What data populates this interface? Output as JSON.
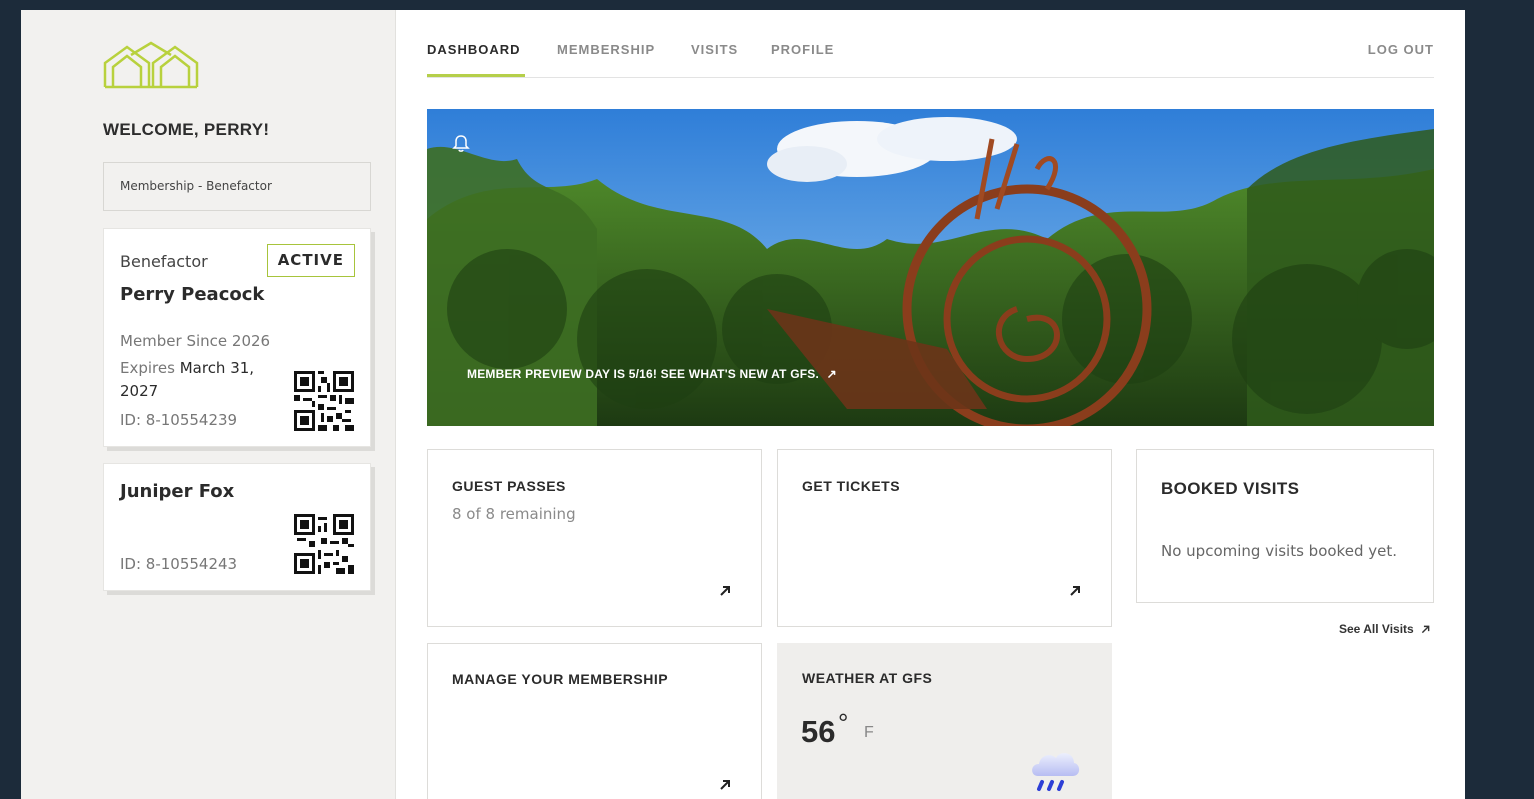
{
  "sidebar": {
    "welcome": "WELCOME, PERRY!",
    "membership_select": "Membership - Benefactor",
    "members": [
      {
        "tier": "Benefactor",
        "status": "ACTIVE",
        "name": "Perry Peacock",
        "since": "Member Since 2026",
        "expires_label": "Expires",
        "expires_value": "March 31, 2027",
        "id": "ID: 8-10554239"
      },
      {
        "name": "Juniper Fox",
        "id": "ID: 8-10554243"
      }
    ]
  },
  "nav": {
    "items": [
      "DASHBOARD",
      "MEMBERSHIP",
      "VISITS",
      "PROFILE"
    ],
    "active": "DASHBOARD",
    "logout": "LOG OUT"
  },
  "hero": {
    "caption": "MEMBER PREVIEW DAY IS 5/16! SEE WHAT'S NEW AT GFS.",
    "caption_arrow": "↗"
  },
  "tiles": {
    "guest_passes": {
      "title": "GUEST PASSES",
      "subtitle": "8 of 8 remaining"
    },
    "get_tickets": {
      "title": "GET TICKETS"
    },
    "booked_visits": {
      "title": "BOOKED VISITS",
      "empty": "No upcoming visits booked yet."
    },
    "see_all": "See All Visits",
    "manage": {
      "title": "MANAGE YOUR MEMBERSHIP"
    },
    "weather": {
      "title": "WEATHER AT GFS",
      "temp": "56",
      "deg": "°",
      "unit": "F",
      "icon": "rain-cloud-icon"
    }
  },
  "colors": {
    "accent": "#b5cf4a",
    "frame": "#1c2b3a",
    "sidebar_bg": "#f2f1ef"
  }
}
